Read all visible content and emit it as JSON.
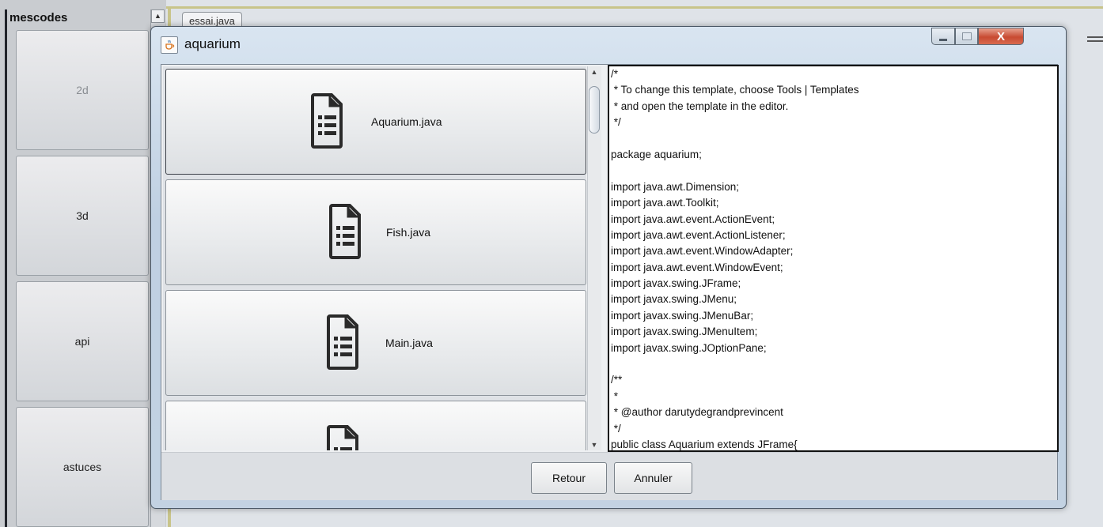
{
  "background": {
    "panel_title": "mescodes",
    "categories": [
      "2d",
      "3d",
      "api",
      "astuces"
    ],
    "tab_label": "essai.java",
    "scroll_up_glyph": "▲"
  },
  "dialog": {
    "title": "aquarium",
    "app_icon": "java-cup-icon",
    "close_glyph": "X",
    "files": [
      {
        "name": "Aquarium.java",
        "icon": "file-document-icon"
      },
      {
        "name": "Fish.java",
        "icon": "file-document-icon"
      },
      {
        "name": "Main.java",
        "icon": "file-document-icon"
      },
      {
        "name": "",
        "icon": "file-document-icon"
      }
    ],
    "scroll_up_glyph": "▲",
    "scroll_down_glyph": "▼",
    "code_lines": [
      "/*",
      " * To change this template, choose Tools | Templates",
      " * and open the template in the editor.",
      " */",
      "",
      "package aquarium;",
      "",
      "import java.awt.Dimension;",
      "import java.awt.Toolkit;",
      "import java.awt.event.ActionEvent;",
      "import java.awt.event.ActionListener;",
      "import java.awt.event.WindowAdapter;",
      "import java.awt.event.WindowEvent;",
      "import javax.swing.JFrame;",
      "import javax.swing.JMenu;",
      "import javax.swing.JMenuBar;",
      "import javax.swing.JMenuItem;",
      "import javax.swing.JOptionPane;",
      "",
      "/**",
      " *",
      " * @author darutydegrandprevincent",
      " */",
      "public class Aquarium extends JFrame{"
    ],
    "buttons": {
      "back": "Retour",
      "cancel": "Annuler"
    }
  }
}
